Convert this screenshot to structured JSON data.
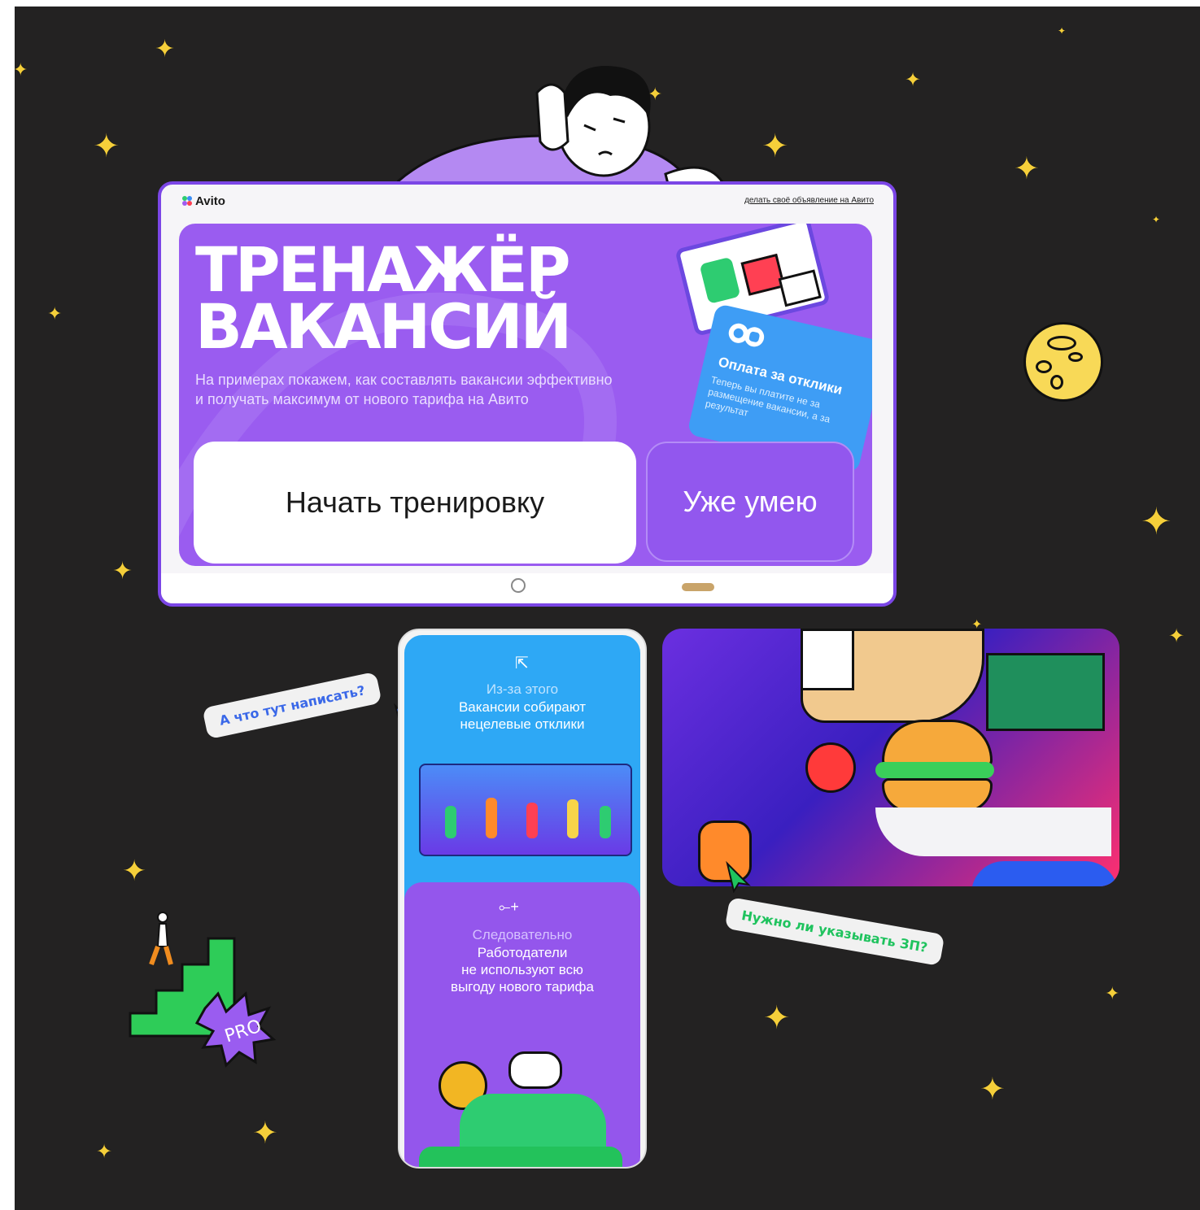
{
  "card": {
    "logo": "Avito",
    "top_link": "делать своё объявление на Авито",
    "title_line1": "ТРЕНАЖЁР",
    "title_line2": "ВАКАНСИЙ",
    "subtitle_line1": "На примерах покажем, как составлять вакансии эффективно",
    "subtitle_line2": "и получать максимум от нового тарифа на Авито",
    "primary_button": "Начать тренировку",
    "secondary_button": "Уже умею",
    "promo_title": "Оплата за отклики",
    "promo_text": "Теперь вы платите не за размещение вакансии, а за результат"
  },
  "phone": {
    "top_caption": "Из-за этого",
    "top_text_line1": "Вакансии собирают",
    "top_text_line2": "нецелевые отклики",
    "bottom_caption": "Следовательно",
    "bottom_text_line1": "Работодатели",
    "bottom_text_line2": "не используют всю",
    "bottom_text_line3": "выгоду нового тарифа"
  },
  "bubbles": {
    "question_blue": "А что тут написать?",
    "question_green": "Нужно ли указывать ЗП?"
  },
  "badge": "PRO",
  "colors": {
    "background": "#232222",
    "avito_purple": "#9a5cf0",
    "card_border": "#7b46e6",
    "phone_blue": "#2ea8f5",
    "bubble_blue_text": "#3a68e8",
    "bubble_green_text": "#1fc35e",
    "star": "#f5cf3a",
    "moon": "#f8d957"
  }
}
